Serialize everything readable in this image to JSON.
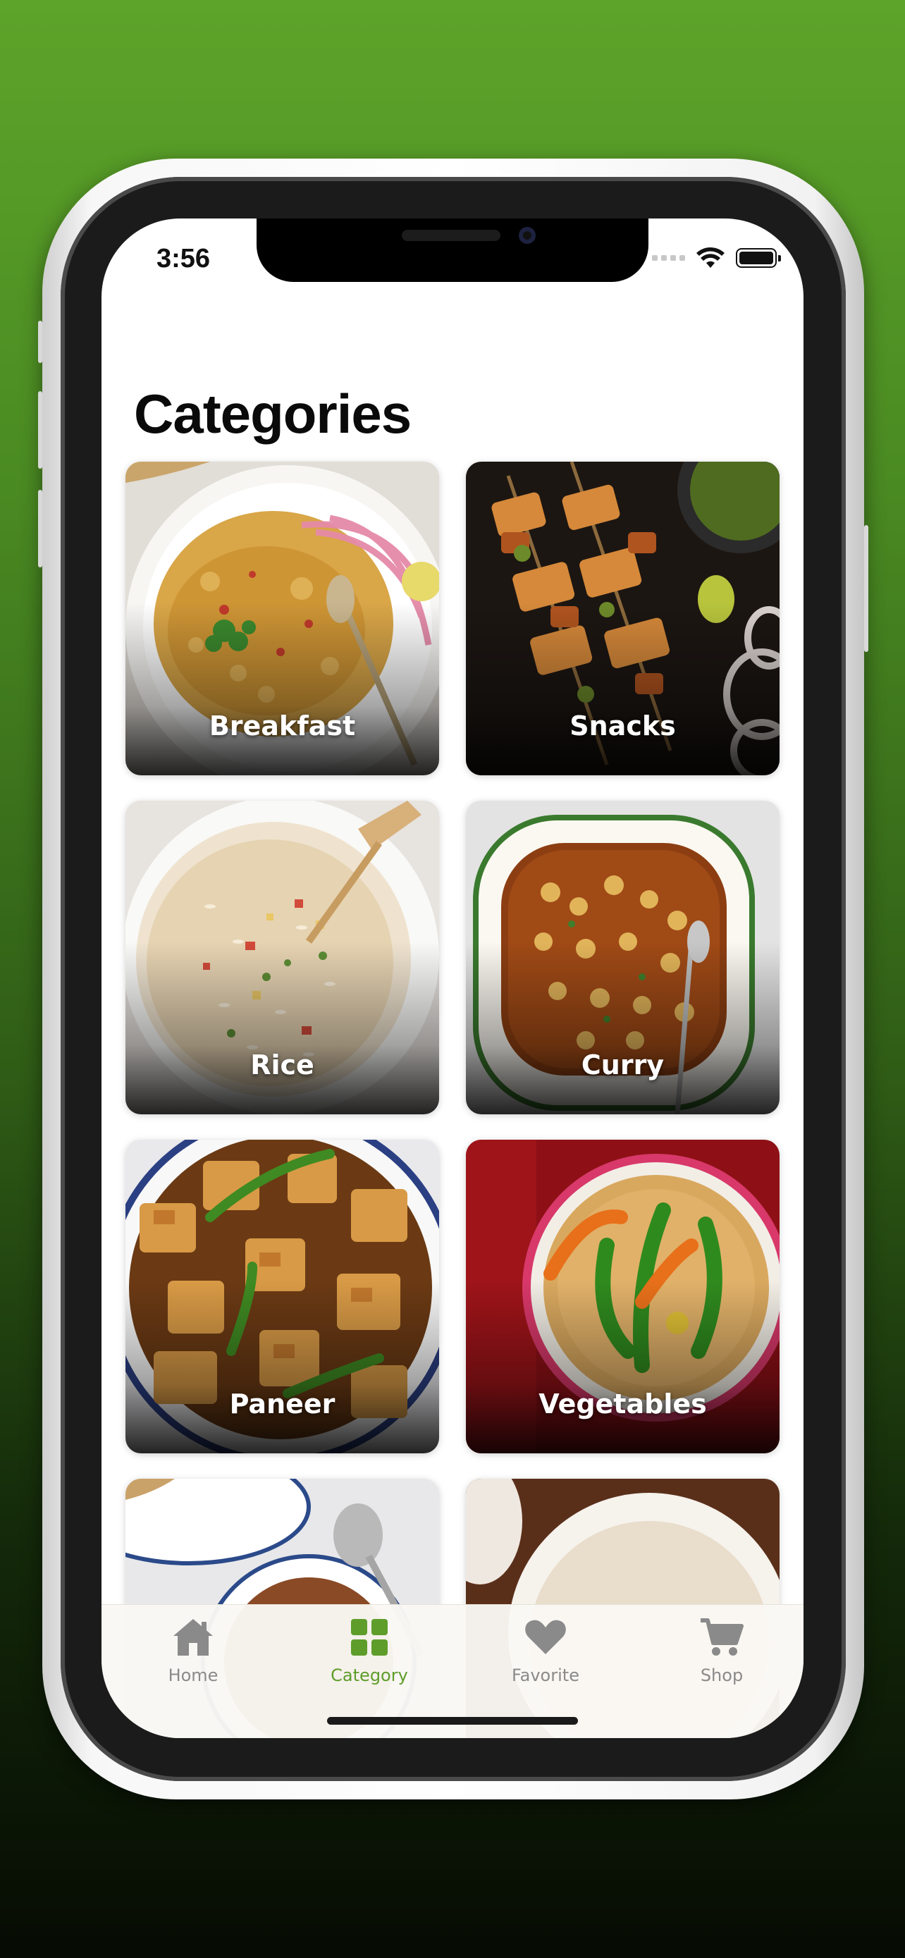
{
  "status_bar": {
    "time": "3:56"
  },
  "page": {
    "title": "Categories"
  },
  "categories": [
    {
      "label": "Breakfast"
    },
    {
      "label": "Snacks"
    },
    {
      "label": "Rice"
    },
    {
      "label": "Curry"
    },
    {
      "label": "Paneer"
    },
    {
      "label": "Vegetables"
    }
  ],
  "tab_bar": {
    "items": [
      {
        "label": "Home",
        "icon": "home-icon"
      },
      {
        "label": "Category",
        "icon": "grid-icon",
        "active": true
      },
      {
        "label": "Favorite",
        "icon": "heart-icon"
      },
      {
        "label": "Shop",
        "icon": "cart-icon"
      }
    ]
  },
  "colors": {
    "accent": "#5e9d2a",
    "inactive_tab": "#8a8a8a",
    "background_top": "#5da42a",
    "background_bottom": "#060b03"
  }
}
